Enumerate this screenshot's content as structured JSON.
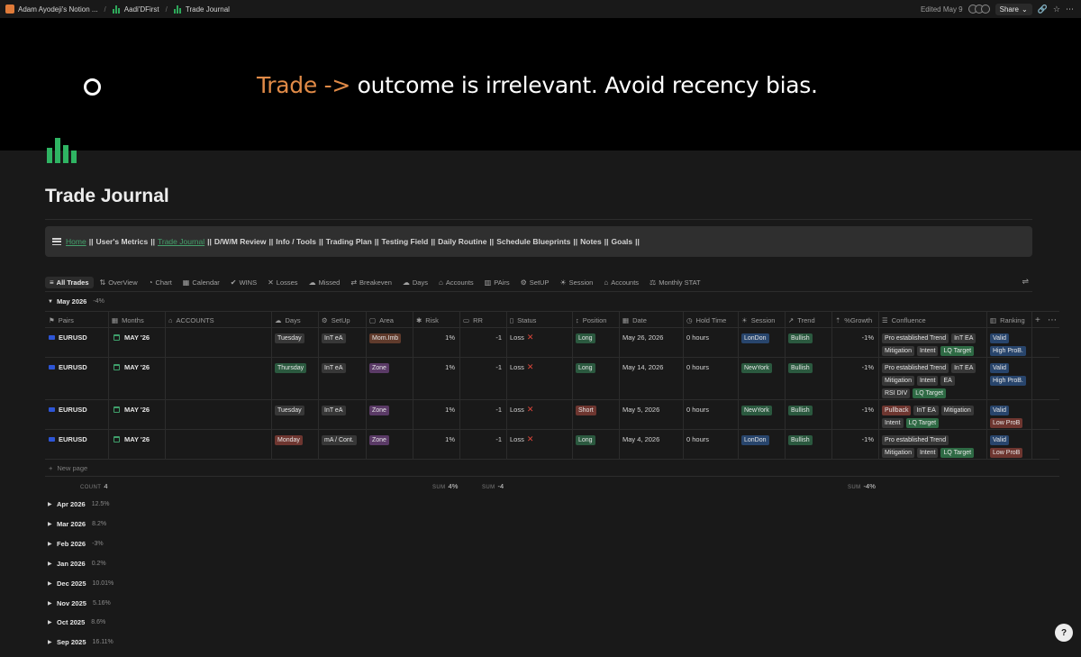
{
  "topbar": {
    "breadcrumbs": [
      "Adam Ayodeji's Notion ...",
      "Aadi'DFirst",
      "Trade Journal"
    ],
    "edited": "Edited May 9",
    "share_label": "Share"
  },
  "banner": {
    "accent_text": "Trade ->",
    "text": "outcome is irrelevant. Avoid recency bias."
  },
  "page": {
    "title": "Trade Journal"
  },
  "nav": {
    "items": [
      {
        "label": "Home",
        "link": true
      },
      {
        "label": "User's Metrics",
        "link": false
      },
      {
        "label": "Trade Journal",
        "link": true
      },
      {
        "label": "D/W/M Review",
        "link": false
      },
      {
        "label": "Info / Tools",
        "link": false
      },
      {
        "label": "Trading Plan",
        "link": false
      },
      {
        "label": "Testing Field",
        "link": false
      },
      {
        "label": "Daily Routine",
        "link": false
      },
      {
        "label": "Schedule Blueprints",
        "link": false
      },
      {
        "label": "Notes",
        "link": false
      },
      {
        "label": "Goals",
        "link": false
      }
    ],
    "separator": "||"
  },
  "views": [
    {
      "label": "All Trades",
      "icon": "≡",
      "active": true
    },
    {
      "label": "OverView",
      "icon": "⇅"
    },
    {
      "label": "Chart",
      "icon": "◔"
    },
    {
      "label": "Calendar",
      "icon": "▦"
    },
    {
      "label": "WINS",
      "icon": "✔"
    },
    {
      "label": "Losses",
      "icon": "✕"
    },
    {
      "label": "Missed",
      "icon": "☁"
    },
    {
      "label": "Breakeven",
      "icon": "⇄"
    },
    {
      "label": "Days",
      "icon": "☁"
    },
    {
      "label": "Accounts",
      "icon": "⌂"
    },
    {
      "label": "PAirs",
      "icon": "▥"
    },
    {
      "label": "SetUP",
      "icon": "⚙"
    },
    {
      "label": "Session",
      "icon": "☀"
    },
    {
      "label": "Accounts",
      "icon": "⌂"
    },
    {
      "label": "Monthly STAT",
      "icon": "⚖"
    }
  ],
  "groups": {
    "current": {
      "name": "May 2026",
      "value": "-4%"
    },
    "collapsed": [
      {
        "name": "Apr 2026",
        "value": "12.5%"
      },
      {
        "name": "Mar 2026",
        "value": "8.2%"
      },
      {
        "name": "Feb 2026",
        "value": "-3%"
      },
      {
        "name": "Jan 2026",
        "value": "0.2%"
      },
      {
        "name": "Dec 2025",
        "value": "10.01%"
      },
      {
        "name": "Nov 2025",
        "value": "5.16%"
      },
      {
        "name": "Oct 2025",
        "value": "8.6%"
      },
      {
        "name": "Sep 2025",
        "value": "16.11%"
      }
    ]
  },
  "columns": [
    {
      "label": "Pairs",
      "icon": "⚑"
    },
    {
      "label": "Months",
      "icon": "▦"
    },
    {
      "label": "ACCOUNTS",
      "icon": "⌂"
    },
    {
      "label": "Days",
      "icon": "☁"
    },
    {
      "label": "SetUp",
      "icon": "⚙"
    },
    {
      "label": "Area",
      "icon": "▢"
    },
    {
      "label": "Risk",
      "icon": "✱"
    },
    {
      "label": "RR",
      "icon": "▭"
    },
    {
      "label": "Status",
      "icon": "▯"
    },
    {
      "label": "Position",
      "icon": "↕"
    },
    {
      "label": "Date",
      "icon": "▦"
    },
    {
      "label": "Hold Time",
      "icon": "◷"
    },
    {
      "label": "Session",
      "icon": "☀"
    },
    {
      "label": "Trend",
      "icon": "↗"
    },
    {
      "label": "%Growth",
      "icon": "⇡"
    },
    {
      "label": "Confluence",
      "icon": "☰"
    },
    {
      "label": "Ranking",
      "icon": "▥"
    }
  ],
  "rows": [
    {
      "pair": "EURUSD",
      "month": "MAY '26",
      "account": "",
      "day": {
        "label": "Tuesday",
        "color": "gray"
      },
      "setup": {
        "label": "InT eA",
        "color": "gray"
      },
      "area": {
        "label": "Mom.Imb",
        "color": "brown"
      },
      "risk": "1%",
      "rr": "-1",
      "status": "Loss",
      "position": {
        "label": "Long",
        "color": "green"
      },
      "date": "May 26, 2026",
      "hold": "0 hours",
      "session": {
        "label": "LonDon",
        "color": "blue"
      },
      "trend": {
        "label": "Bullish",
        "color": "green"
      },
      "growth": "-1%",
      "confluence": [
        {
          "label": "Pro established Trend",
          "color": "gray"
        },
        {
          "label": "InT EA",
          "color": "gray"
        },
        {
          "label": "Mitigation",
          "color": "gray"
        },
        {
          "label": "Intent",
          "color": "gray"
        },
        {
          "label": "LQ Target",
          "color": "bright-green"
        }
      ],
      "ranking": [
        {
          "label": "Valid",
          "color": "blue"
        },
        {
          "label": "High ProB.",
          "color": "blue"
        }
      ]
    },
    {
      "pair": "EURUSD",
      "month": "MAY '26",
      "account": "",
      "day": {
        "label": "Thursday",
        "color": "green"
      },
      "setup": {
        "label": "InT eA",
        "color": "gray"
      },
      "area": {
        "label": "Zone",
        "color": "purple"
      },
      "risk": "1%",
      "rr": "-1",
      "status": "Loss",
      "position": {
        "label": "Long",
        "color": "green"
      },
      "date": "May 14, 2026",
      "hold": "0 hours",
      "session": {
        "label": "NewYork",
        "color": "green"
      },
      "trend": {
        "label": "Bullish",
        "color": "green"
      },
      "growth": "-1%",
      "confluence": [
        {
          "label": "Pro established Trend",
          "color": "gray"
        },
        {
          "label": "InT EA",
          "color": "gray"
        },
        {
          "label": "Mitigation",
          "color": "gray"
        },
        {
          "label": "Intent",
          "color": "gray"
        },
        {
          "label": "EA",
          "color": "gray"
        },
        {
          "label": "RSI DIV",
          "color": "gray"
        },
        {
          "label": "LQ Target",
          "color": "bright-green"
        }
      ],
      "ranking": [
        {
          "label": "Valid",
          "color": "blue"
        },
        {
          "label": "High ProB.",
          "color": "blue"
        }
      ]
    },
    {
      "pair": "EURUSD",
      "month": "MAY '26",
      "account": "",
      "day": {
        "label": "Tuesday",
        "color": "gray"
      },
      "setup": {
        "label": "InT eA",
        "color": "gray"
      },
      "area": {
        "label": "Zone",
        "color": "purple"
      },
      "risk": "1%",
      "rr": "-1",
      "status": "Loss",
      "position": {
        "label": "Short",
        "color": "red"
      },
      "date": "May 5, 2026",
      "hold": "0 hours",
      "session": {
        "label": "NewYork",
        "color": "green"
      },
      "trend": {
        "label": "Bullish",
        "color": "green"
      },
      "growth": "-1%",
      "confluence": [
        {
          "label": "Pullback",
          "color": "red"
        },
        {
          "label": "InT EA",
          "color": "gray"
        },
        {
          "label": "Mitigation",
          "color": "gray"
        },
        {
          "label": "Intent",
          "color": "gray"
        },
        {
          "label": "LQ Target",
          "color": "bright-green"
        }
      ],
      "ranking": [
        {
          "label": "Valid",
          "color": "blue"
        },
        {
          "label": "Low ProB",
          "color": "red"
        }
      ]
    },
    {
      "pair": "EURUSD",
      "month": "MAY '26",
      "account": "",
      "day": {
        "label": "Monday",
        "color": "red"
      },
      "setup": {
        "label": "mA / Cont.",
        "color": "gray"
      },
      "area": {
        "label": "Zone",
        "color": "purple"
      },
      "risk": "1%",
      "rr": "-1",
      "status": "Loss",
      "position": {
        "label": "Long",
        "color": "green"
      },
      "date": "May 4, 2026",
      "hold": "0 hours",
      "session": {
        "label": "LonDon",
        "color": "blue"
      },
      "trend": {
        "label": "Bullish",
        "color": "green"
      },
      "growth": "-1%",
      "confluence": [
        {
          "label": "Pro established Trend",
          "color": "gray"
        },
        {
          "label": "Mitigation",
          "color": "gray"
        },
        {
          "label": "Intent",
          "color": "gray"
        },
        {
          "label": "LQ Target",
          "color": "bright-green"
        }
      ],
      "ranking": [
        {
          "label": "Valid",
          "color": "blue"
        },
        {
          "label": "Low ProB",
          "color": "red"
        }
      ]
    }
  ],
  "new_page_label": "New page",
  "calculations": {
    "count_label": "COUNT",
    "count": "4",
    "risk_label": "SUM",
    "risk_sum": "4%",
    "rr_label": "SUM",
    "rr_sum": "-4",
    "growth_label": "SUM",
    "growth_sum": "-4%"
  },
  "help_label": "?"
}
